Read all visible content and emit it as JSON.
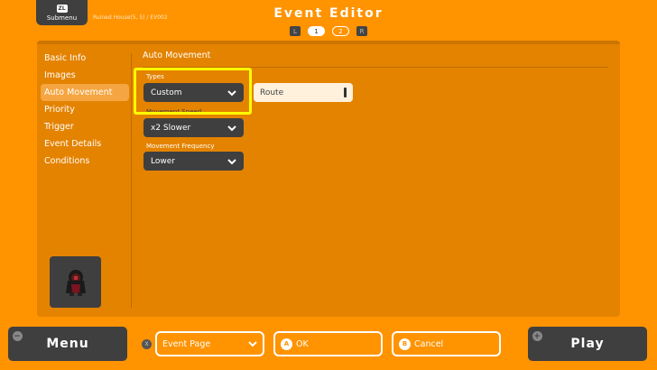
{
  "header": {
    "submenu_key": "ZL",
    "submenu_label": "Submenu",
    "breadcrumb": "Ruined House(5, 5) / EV002",
    "title": "Event Editor",
    "pager": {
      "left_key": "L",
      "right_key": "R",
      "pages": [
        "1",
        "2"
      ],
      "active_page": "1"
    }
  },
  "sidebar": {
    "items": [
      {
        "label": "Basic Info"
      },
      {
        "label": "Images"
      },
      {
        "label": "Auto Movement"
      },
      {
        "label": "Priority"
      },
      {
        "label": "Trigger"
      },
      {
        "label": "Event Details"
      },
      {
        "label": "Conditions"
      }
    ],
    "active": "Auto Movement"
  },
  "main": {
    "section_title": "Auto Movement",
    "types": {
      "label": "Types",
      "value": "Custom"
    },
    "route_button": "Route",
    "movement_speed": {
      "label": "Movement Speed",
      "value": "x2 Slower"
    },
    "movement_frequency": {
      "label": "Movement Frequency",
      "value": "Lower"
    }
  },
  "footer": {
    "menu_button": "Menu",
    "menu_corner": "−",
    "event_page_key": "X",
    "event_page": "Event Page",
    "ok_key": "A",
    "ok_label": "OK",
    "cancel_key": "B",
    "cancel_label": "Cancel",
    "play_button": "Play",
    "play_corner": "+"
  },
  "colors": {
    "background": "#ff9300",
    "panel": "#e48300",
    "dark": "#3f3f3f",
    "highlight": "#ffff00"
  }
}
